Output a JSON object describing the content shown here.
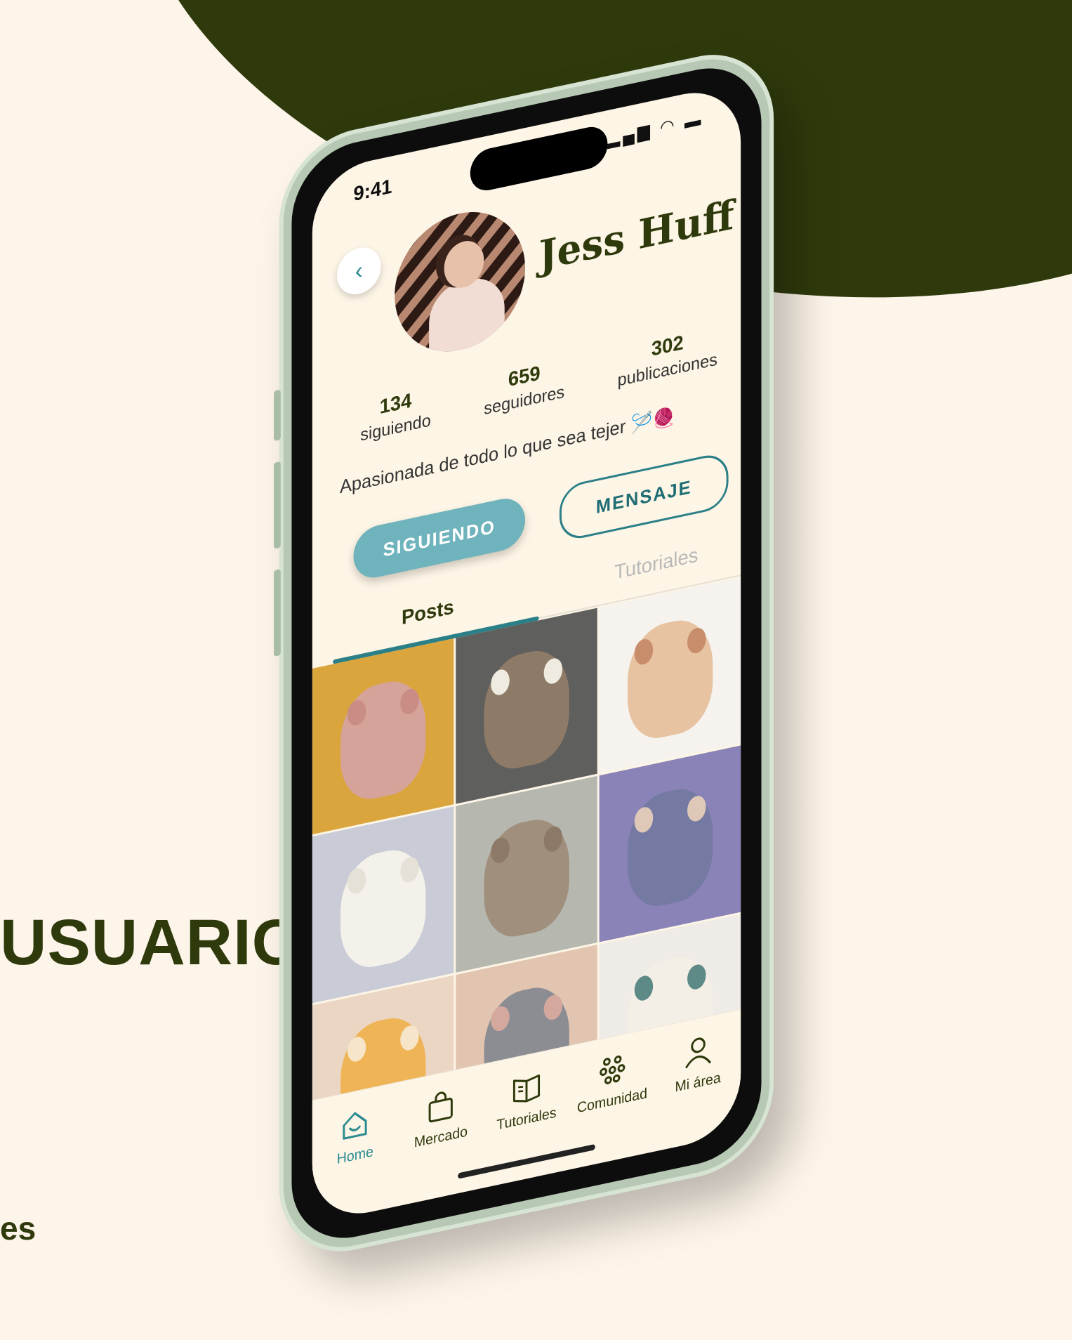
{
  "page": {
    "side_title": "USUARIO",
    "side_subtitle": "es"
  },
  "status_bar": {
    "time": "9:41",
    "icons": "▂▄▆ ◠ ▬"
  },
  "profile": {
    "name": "Jess Huff",
    "stats": [
      {
        "value": "134",
        "label": "siguiendo"
      },
      {
        "value": "659",
        "label": "seguidores"
      },
      {
        "value": "302",
        "label": "publicaciones"
      }
    ],
    "bio": "Apasionada de todo lo que sea tejer 🪡🧶"
  },
  "actions": {
    "follow_label": "SIGUIENDO",
    "message_label": "MENSAJE"
  },
  "tabs": [
    {
      "label": "Posts",
      "active": true
    },
    {
      "label": "Tutoriales",
      "active": false
    }
  ],
  "posts": [
    {
      "subject": "pig-amigurumi",
      "bg": "#d9a53c",
      "toy": "#d6a39a",
      "ear": "#c98d85"
    },
    {
      "subject": "bear-amigurumi",
      "bg": "#5f5f5e",
      "toy": "#8e7b67",
      "ear": "#f0ebe0"
    },
    {
      "subject": "puppy-amigurumi",
      "bg": "#f6f3ee",
      "toy": "#e7c3a2",
      "ear": "#c88d6b"
    },
    {
      "subject": "sheep-amigurumi",
      "bg": "#c9ccd6",
      "toy": "#f3f1ea",
      "ear": "#e6e1d6"
    },
    {
      "subject": "cat-amigurumi",
      "bg": "#b6b8b0",
      "toy": "#a08f7c",
      "ear": "#8c7a66"
    },
    {
      "subject": "bunnies-amigurumi",
      "bg": "#8a83b8",
      "toy": "#757aa3",
      "ear": "#e0c8b8"
    },
    {
      "subject": "giraffes-amigurumi",
      "bg": "#ebd6c4",
      "toy": "#efb455",
      "ear": "#f6e5c8"
    },
    {
      "subject": "grey-cat-amigurumi",
      "bg": "#e2c5b0",
      "toy": "#8c8d92",
      "ear": "#d5a89e"
    },
    {
      "subject": "baby-with-toys",
      "bg": "#efebe6",
      "toy": "#f4efe6",
      "ear": "#5d8a86"
    }
  ],
  "nav": [
    {
      "label": "Home",
      "icon": "home-icon",
      "active": true
    },
    {
      "label": "Mercado",
      "icon": "shopping-bag-icon",
      "active": false
    },
    {
      "label": "Tutoriales",
      "icon": "open-book-icon",
      "active": false
    },
    {
      "label": "Comunidad",
      "icon": "community-icon",
      "active": false
    },
    {
      "label": "Mi área",
      "icon": "user-icon",
      "active": false
    }
  ],
  "colors": {
    "brand_dark": "#2f3a0c",
    "accent_teal": "#2b8a8f",
    "button_teal": "#6fb3bd",
    "background": "#fdf5e9"
  }
}
